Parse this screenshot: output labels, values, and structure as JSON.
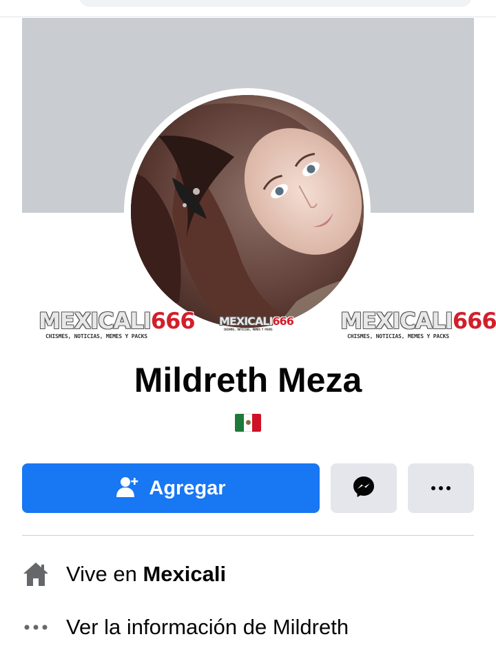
{
  "profile": {
    "name": "Mildreth Meza",
    "flag_icon": "mexico-flag-icon"
  },
  "watermark": {
    "brand_part1": "MEXICALI",
    "brand_part2": "666",
    "tagline": "CHISMES, NOTICIAS, MEMES Y PACKS"
  },
  "actions": {
    "add_label": "Agregar",
    "add_icon": "add-friend-icon",
    "messenger_icon": "messenger-icon",
    "more_icon": "more-icon"
  },
  "intro": {
    "lives_prefix": "Vive en",
    "lives_city": "Mexicali",
    "lives_icon": "home-icon",
    "see_info": "Ver la información de Mildreth",
    "see_info_icon": "ellipsis-icon"
  },
  "colors": {
    "primary": "#1877f2",
    "secondary_button": "#e4e6eb",
    "cover": "#c9ccd1",
    "text": "#050505",
    "icon_grey": "#65676b"
  }
}
